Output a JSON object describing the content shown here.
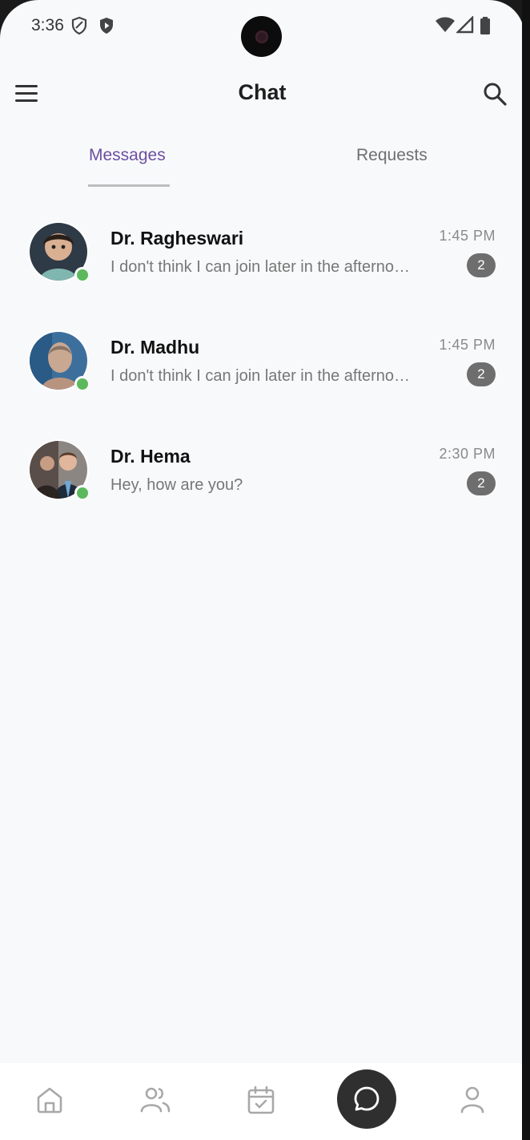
{
  "status_bar": {
    "time": "3:36",
    "icons": [
      "shield-icon",
      "play-protect-icon",
      "wifi-icon",
      "signal-icon",
      "battery-icon"
    ]
  },
  "app_bar": {
    "title": "Chat",
    "menu_icon": "hamburger-menu-icon",
    "search_icon": "search-icon"
  },
  "tabs": {
    "messages": "Messages",
    "requests": "Requests",
    "active": "messages",
    "active_color": "#6b4fa0"
  },
  "chats": [
    {
      "name": "Dr. Ragheswari",
      "preview": "I don't think I can join later in the afternoon",
      "time": "1:45 PM",
      "unread": "2",
      "online": true
    },
    {
      "name": "Dr. Madhu",
      "preview": "I don't think I can join later in the afternoon",
      "time": "1:45 PM",
      "unread": "2",
      "online": true
    },
    {
      "name": "Dr. Hema",
      "preview": "Hey, how are you?",
      "time": "2:30 PM",
      "unread": "2",
      "online": true
    }
  ],
  "bottom_nav": {
    "items": [
      "home-icon",
      "people-icon",
      "calendar-check-icon",
      "chat-bubble-icon",
      "profile-icon"
    ],
    "active": "chat-bubble-icon"
  },
  "colors": {
    "background": "#f8f9fb",
    "online": "#5cb85c",
    "badge": "#6e6e6e",
    "active_nav": "#2f2f2f"
  }
}
